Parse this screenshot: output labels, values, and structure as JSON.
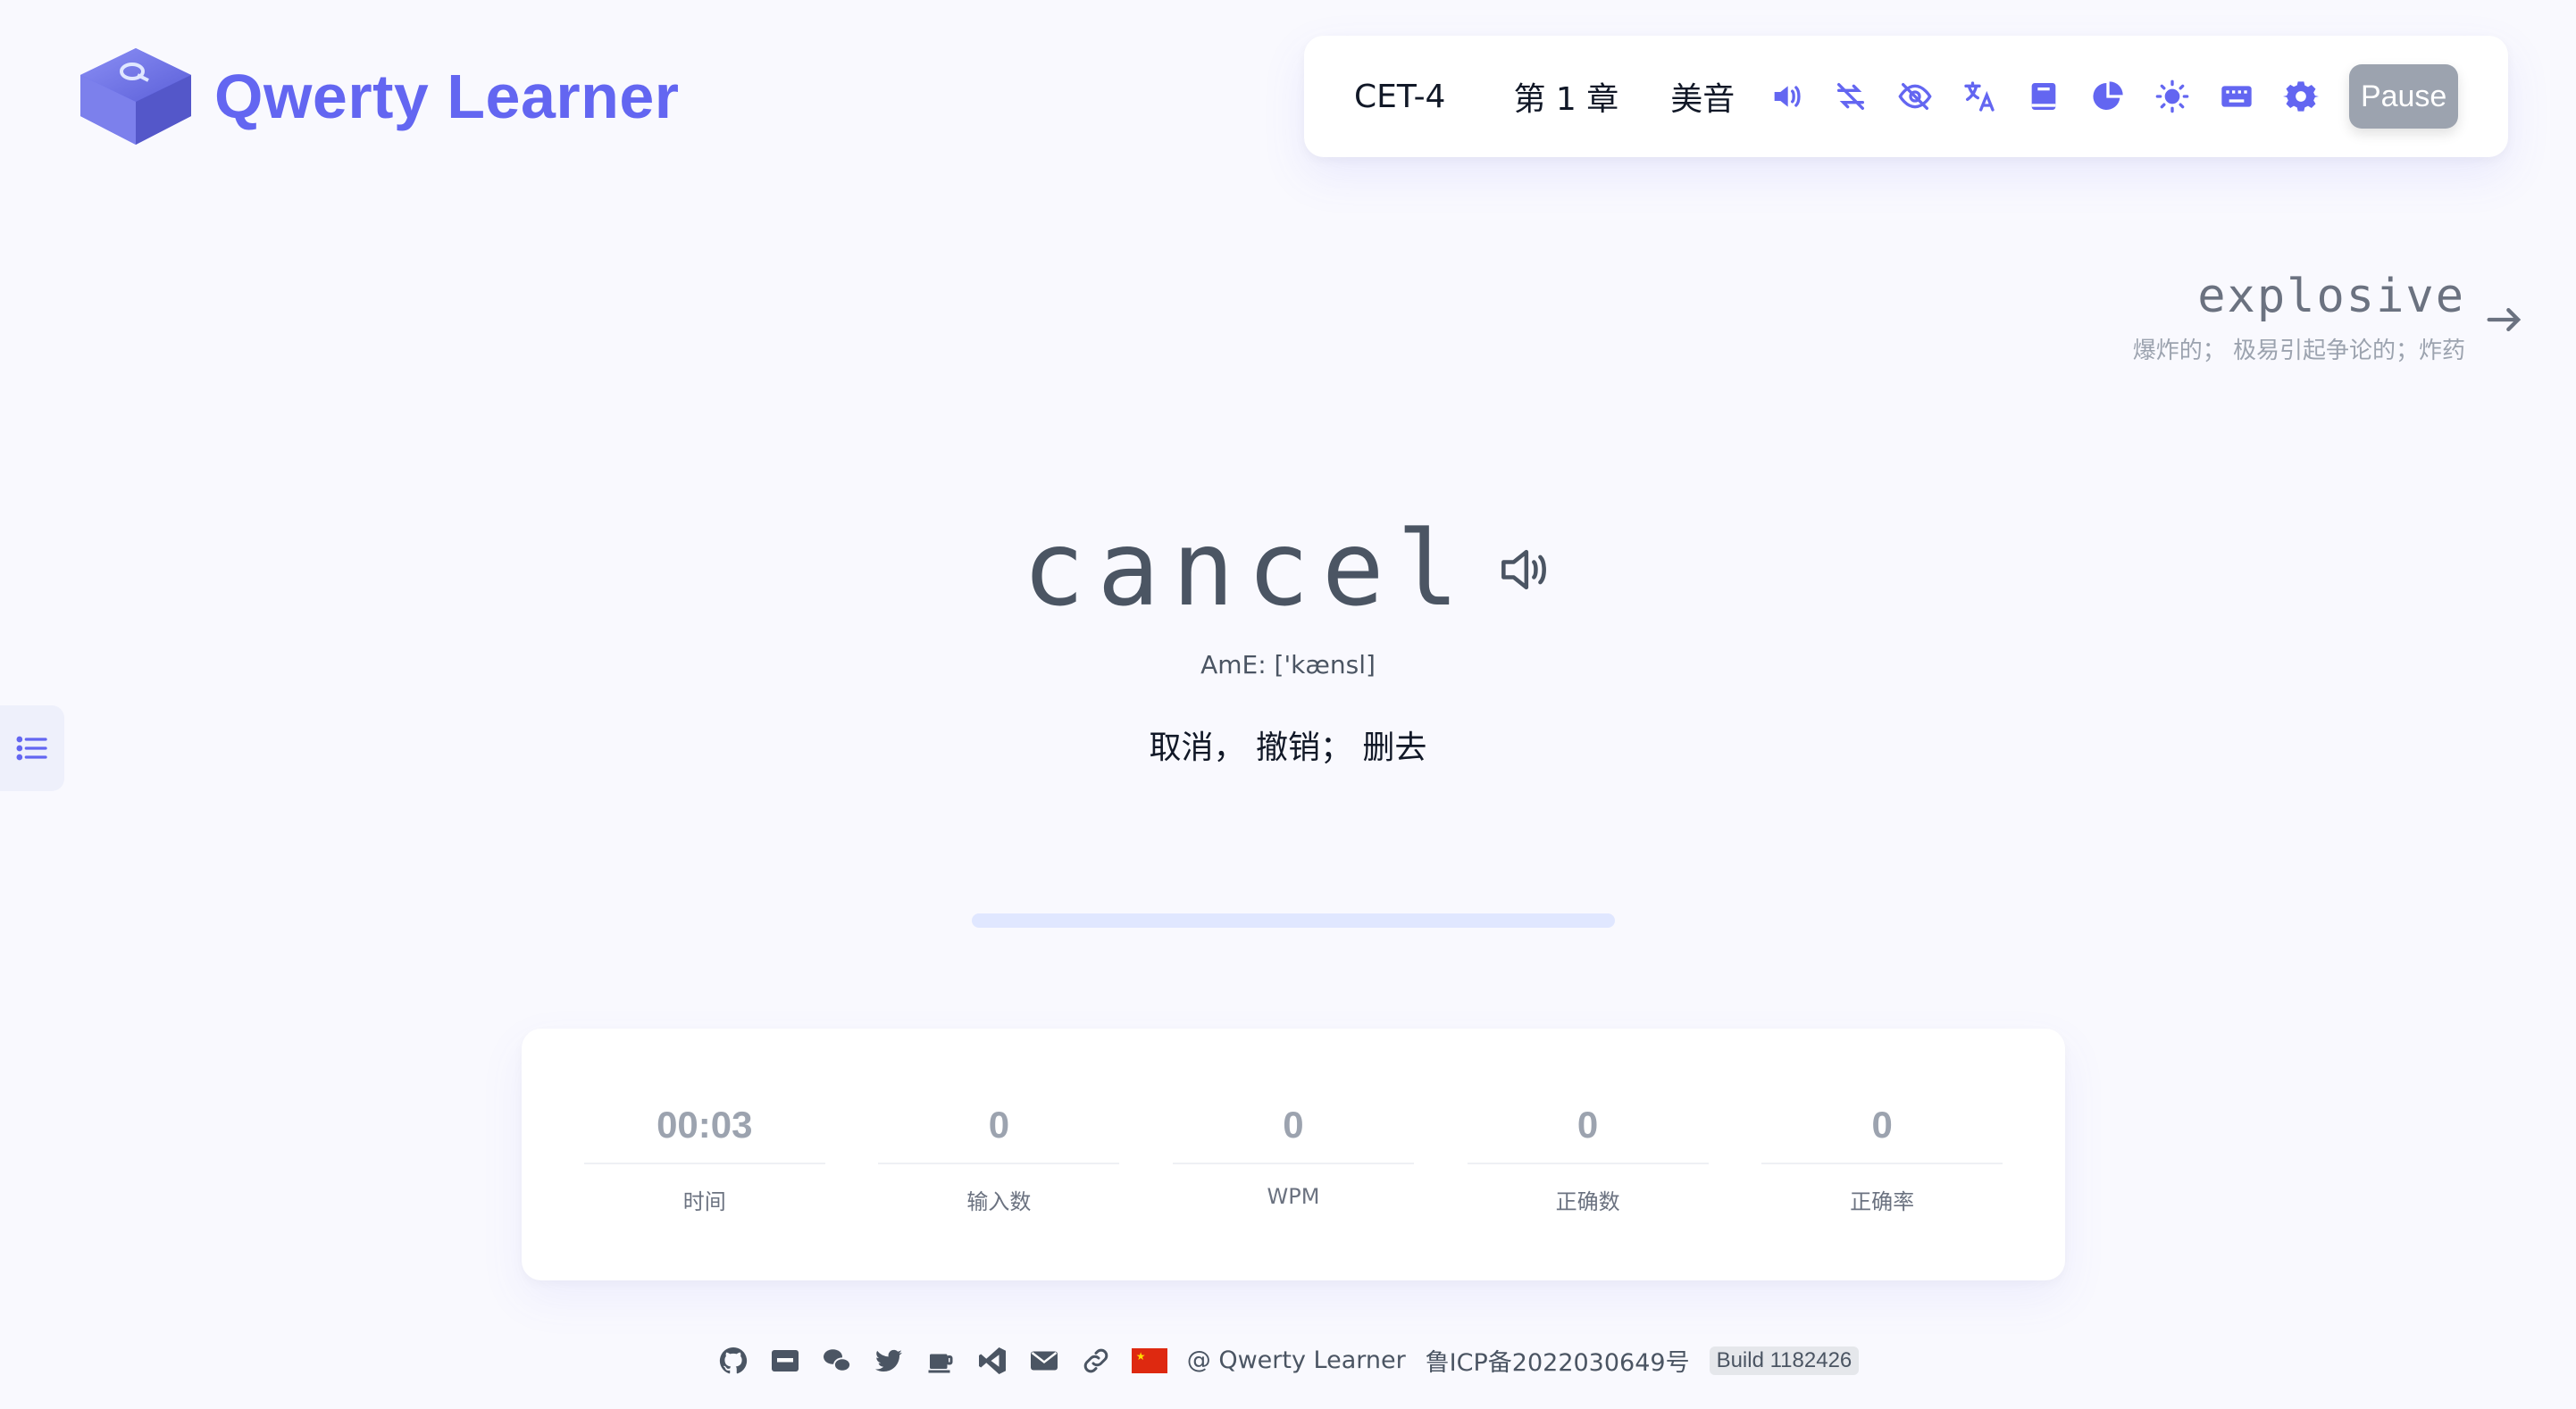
{
  "app": {
    "name": "Qwerty Learner"
  },
  "colors": {
    "accent": "#6366f1",
    "pause_button": "#9ca3af",
    "progress_track": "#e0e7ff"
  },
  "toolbar": {
    "dictionary": "CET-4",
    "chapter": "第 1 章",
    "accent": "美音",
    "icons": [
      "volume-icon",
      "loop-icon",
      "hide-word-icon",
      "translation-icon",
      "dictation-book-icon",
      "stats-icon",
      "theme-icon",
      "keyboard-icon",
      "settings-icon"
    ],
    "pause_label": "Pause"
  },
  "next_word": {
    "word": "explosive",
    "translation": "爆炸的； 极易引起争论的；炸药"
  },
  "current_word": {
    "word": "cancel",
    "phonetic": "AmE: ['kænsl]",
    "translation": "取消， 撤销； 删去"
  },
  "progress": {
    "fraction": 0
  },
  "stats": [
    {
      "value": "00:03",
      "label": "时间"
    },
    {
      "value": "0",
      "label": "输入数"
    },
    {
      "value": "0",
      "label": "WPM"
    },
    {
      "value": "0",
      "label": "正确数"
    },
    {
      "value": "0",
      "label": "正确率"
    }
  ],
  "footer": {
    "icons": [
      "github-icon",
      "xiaohongshu-icon",
      "wechat-icon",
      "twitter-icon",
      "coffee-icon",
      "vscode-icon",
      "mail-icon",
      "link-icon",
      "china-flag-icon"
    ],
    "copyright": "@ Qwerty Learner",
    "icp": "鲁ICP备2022030649号",
    "build": "Build 1182426"
  }
}
